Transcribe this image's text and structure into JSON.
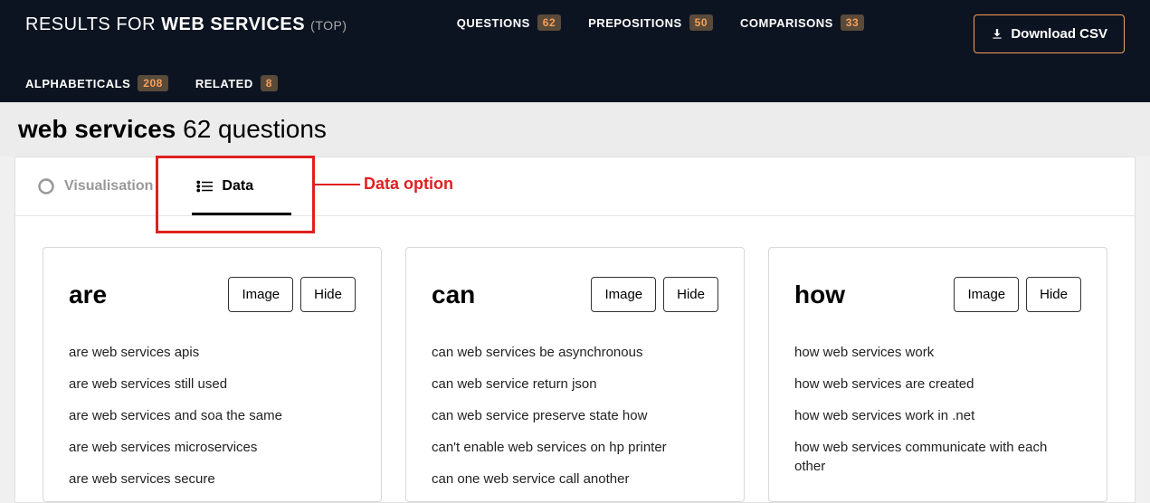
{
  "header": {
    "results_for": "RESULTS FOR",
    "term": "WEB SERVICES",
    "top": "(TOP)",
    "download": "Download CSV",
    "tabs_row1": [
      {
        "label": "QUESTIONS",
        "count": "62"
      },
      {
        "label": "PREPOSITIONS",
        "count": "50"
      },
      {
        "label": "COMPARISONS",
        "count": "33"
      }
    ],
    "tabs_row2": [
      {
        "label": "ALPHABETICALS",
        "count": "208"
      },
      {
        "label": "RELATED",
        "count": "8"
      }
    ]
  },
  "subheader": {
    "term": "web services",
    "count": "62 questions"
  },
  "view_tabs": {
    "visualisation": "Visualisation",
    "data": "Data"
  },
  "annotation": "Data option",
  "buttons": {
    "image": "Image",
    "hide": "Hide"
  },
  "cards": [
    {
      "title": "are",
      "items": [
        "are web services apis",
        "are web services still used",
        "are web services and soa the same",
        "are web services microservices",
        "are web services secure"
      ]
    },
    {
      "title": "can",
      "items": [
        "can web services be asynchronous",
        "can web service return json",
        "can web service preserve state how",
        "can't enable web services on hp printer",
        "can one web service call another"
      ]
    },
    {
      "title": "how",
      "items": [
        "how web services work",
        "how web services are created",
        "how web services work in .net",
        "how web services communicate with each other"
      ]
    }
  ]
}
